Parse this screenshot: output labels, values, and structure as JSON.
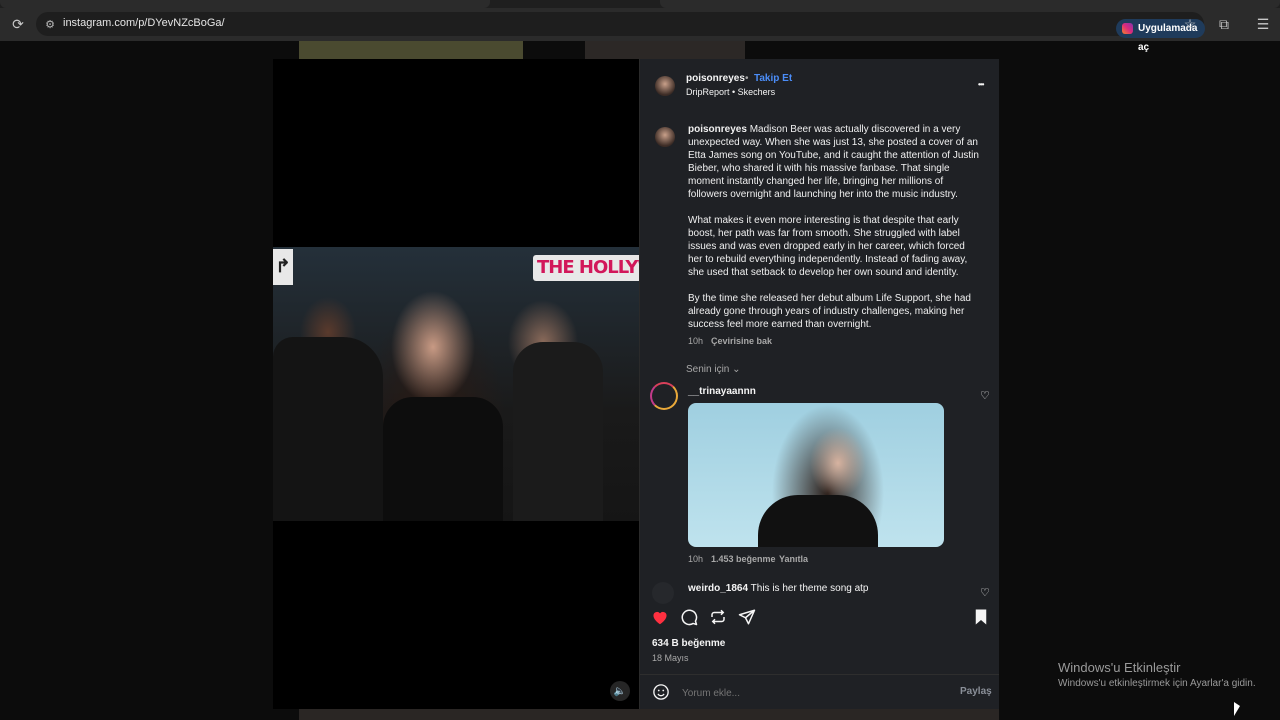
{
  "browser": {
    "url": "instagram.com/p/DYevNZcBoGa/",
    "open_in_app": "Uygulamada aç"
  },
  "post": {
    "author": "poisonreyes",
    "follow_label": "Takip Et",
    "separator": "•",
    "audio": "DripReport • Skechers",
    "more": "•••",
    "caption_author": "poisonreyes",
    "caption_p1": "Madison Beer was actually discovered in a very unexpected way. When she was just 13, she posted a cover of an Etta James song on YouTube, and it caught the attention of Justin Bieber, who shared it with his massive fanbase. That single moment instantly changed her life, bringing her millions of followers overnight and launching her into the music industry.",
    "caption_p2": "What makes it even more interesting is that despite that early boost, her path was far from smooth. She struggled with label issues and was even dropped early in her career, which forced her to rebuild everything independently. Instead of fading away, she used that setback to develop her own sound and identity.",
    "caption_p3": "By the time she released her debut album Life Support, she had already gone through years of industry challenges, making her success feel more earned than overnight.",
    "caption_time": "10h",
    "see_translation": "Çevirisine bak",
    "overlay_text": "THE HOLLYWO",
    "likes": "634 B beğenme",
    "date": "18 Mayıs",
    "comment_placeholder": "Yorum ekle...",
    "share_label": "Paylaş"
  },
  "sort": {
    "label": "Senin için"
  },
  "comments": [
    {
      "user": "__trinayaannn",
      "time": "10h",
      "likes": "1.453 beğenme",
      "reply": "Yanıtla"
    },
    {
      "user": "weirdo_1864",
      "text": "This is her theme song atp"
    }
  ],
  "windows": {
    "title": "Windows'u Etkinleştir",
    "subtitle": "Windows'u etkinleştirmek için Ayarlar'a gidin."
  },
  "colors": {
    "like_red": "#ff3040",
    "follow_blue": "#4b8df8",
    "panel_bg": "#1f2125"
  }
}
